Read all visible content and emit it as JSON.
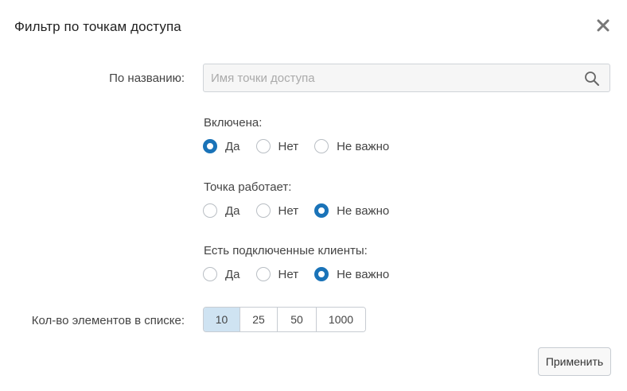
{
  "dialog": {
    "title": "Фильтр по точкам доступа",
    "close_icon": "close-icon"
  },
  "name_filter": {
    "label": "По названию:",
    "placeholder": "Имя точки доступа",
    "value": "",
    "icon": "search-icon"
  },
  "groups": [
    {
      "label": "Включена:",
      "options": [
        {
          "label": "Да",
          "checked": true
        },
        {
          "label": "Нет",
          "checked": false
        },
        {
          "label": "Не важно",
          "checked": false
        }
      ]
    },
    {
      "label": "Точка работает:",
      "options": [
        {
          "label": "Да",
          "checked": false
        },
        {
          "label": "Нет",
          "checked": false
        },
        {
          "label": "Не важно",
          "checked": true
        }
      ]
    },
    {
      "label": "Есть подключенные клиенты:",
      "options": [
        {
          "label": "Да",
          "checked": false
        },
        {
          "label": "Нет",
          "checked": false
        },
        {
          "label": "Не важно",
          "checked": true
        }
      ]
    }
  ],
  "page_size": {
    "label": "Кол-во элементов в списке:",
    "options": [
      "10",
      "25",
      "50",
      "1000"
    ],
    "selected": "10"
  },
  "apply_label": "Применить",
  "colors": {
    "accent": "#1a73b8",
    "selected_segment": "#cfe3f2"
  }
}
